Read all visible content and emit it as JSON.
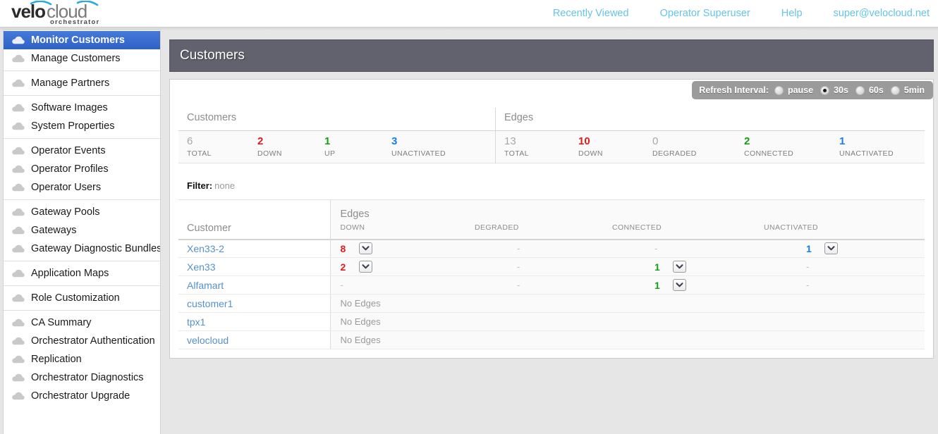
{
  "brand": {
    "name_bold": "velo",
    "name_light": "cloud",
    "subtitle": "orchestrator",
    "accent": "#29abe2"
  },
  "topnav": {
    "links": [
      {
        "label": "Recently Viewed"
      },
      {
        "label": "Operator Superuser"
      },
      {
        "label": "Help"
      },
      {
        "label": "super@velocloud.net"
      }
    ],
    "link_color": "#63c5e8"
  },
  "sidebar": {
    "groups": [
      {
        "items": [
          {
            "label": "Monitor Customers",
            "active": true
          },
          {
            "label": "Manage Customers",
            "active": false
          }
        ]
      },
      {
        "items": [
          {
            "label": "Manage Partners",
            "active": false
          }
        ]
      },
      {
        "items": [
          {
            "label": "Software Images",
            "active": false
          },
          {
            "label": "System Properties",
            "active": false
          }
        ]
      },
      {
        "items": [
          {
            "label": "Operator Events",
            "active": false
          },
          {
            "label": "Operator Profiles",
            "active": false
          },
          {
            "label": "Operator Users",
            "active": false
          }
        ]
      },
      {
        "items": [
          {
            "label": "Gateway Pools",
            "active": false
          },
          {
            "label": "Gateways",
            "active": false
          },
          {
            "label": "Gateway Diagnostic Bundles",
            "active": false
          }
        ]
      },
      {
        "items": [
          {
            "label": "Application Maps",
            "active": false
          }
        ]
      },
      {
        "items": [
          {
            "label": "Role Customization",
            "active": false
          }
        ]
      },
      {
        "items": [
          {
            "label": "CA Summary",
            "active": false
          },
          {
            "label": "Orchestrator Authentication",
            "active": false
          },
          {
            "label": "Replication",
            "active": false
          },
          {
            "label": "Orchestrator Diagnostics",
            "active": false
          },
          {
            "label": "Orchestrator Upgrade",
            "active": false
          }
        ]
      }
    ]
  },
  "page": {
    "title": "Customers"
  },
  "refresh": {
    "label": "Refresh Interval:",
    "options": [
      {
        "label": "pause",
        "selected": false
      },
      {
        "label": "30s",
        "selected": true
      },
      {
        "label": "60s",
        "selected": false
      },
      {
        "label": "5min",
        "selected": false
      }
    ]
  },
  "stats": {
    "customers": {
      "heading": "Customers",
      "items": [
        {
          "value": "6",
          "label": "TOTAL",
          "color": "muted"
        },
        {
          "value": "2",
          "label": "DOWN",
          "color": "red"
        },
        {
          "value": "1",
          "label": "UP",
          "color": "green"
        },
        {
          "value": "3",
          "label": "UNACTIVATED",
          "color": "blue"
        }
      ]
    },
    "edges": {
      "heading": "Edges",
      "items": [
        {
          "value": "13",
          "label": "TOTAL",
          "color": "muted"
        },
        {
          "value": "10",
          "label": "DOWN",
          "color": "red"
        },
        {
          "value": "0",
          "label": "DEGRADED",
          "color": "muted"
        },
        {
          "value": "2",
          "label": "CONNECTED",
          "color": "green"
        },
        {
          "value": "1",
          "label": "UNACTIVATED",
          "color": "blue"
        }
      ]
    }
  },
  "filter": {
    "label": "Filter:",
    "value": "none"
  },
  "table": {
    "customer_header": "Customer",
    "edges_group_header": "Edges",
    "columns": [
      "DOWN",
      "DEGRADED",
      "CONNECTED",
      "UNACTIVATED"
    ],
    "no_edges_text": "No Edges",
    "dash": "-",
    "rows": [
      {
        "customer": "Xen33-2",
        "no_edges": false,
        "down": "8",
        "down_dd": true,
        "degraded": "-",
        "degraded_dd": false,
        "connected": "-",
        "connected_dd": false,
        "unactivated": "1",
        "unactivated_dd": true
      },
      {
        "customer": "Xen33",
        "no_edges": false,
        "down": "2",
        "down_dd": true,
        "degraded": "-",
        "degraded_dd": false,
        "connected": "1",
        "connected_dd": true,
        "unactivated": "-",
        "unactivated_dd": false
      },
      {
        "customer": "Alfamart",
        "no_edges": false,
        "down": "-",
        "down_dd": false,
        "degraded": "-",
        "degraded_dd": false,
        "connected": "1",
        "connected_dd": true,
        "unactivated": "-",
        "unactivated_dd": false
      },
      {
        "customer": "customer1",
        "no_edges": true
      },
      {
        "customer": "tpx1",
        "no_edges": true
      },
      {
        "customer": "velocloud",
        "no_edges": true
      }
    ]
  }
}
